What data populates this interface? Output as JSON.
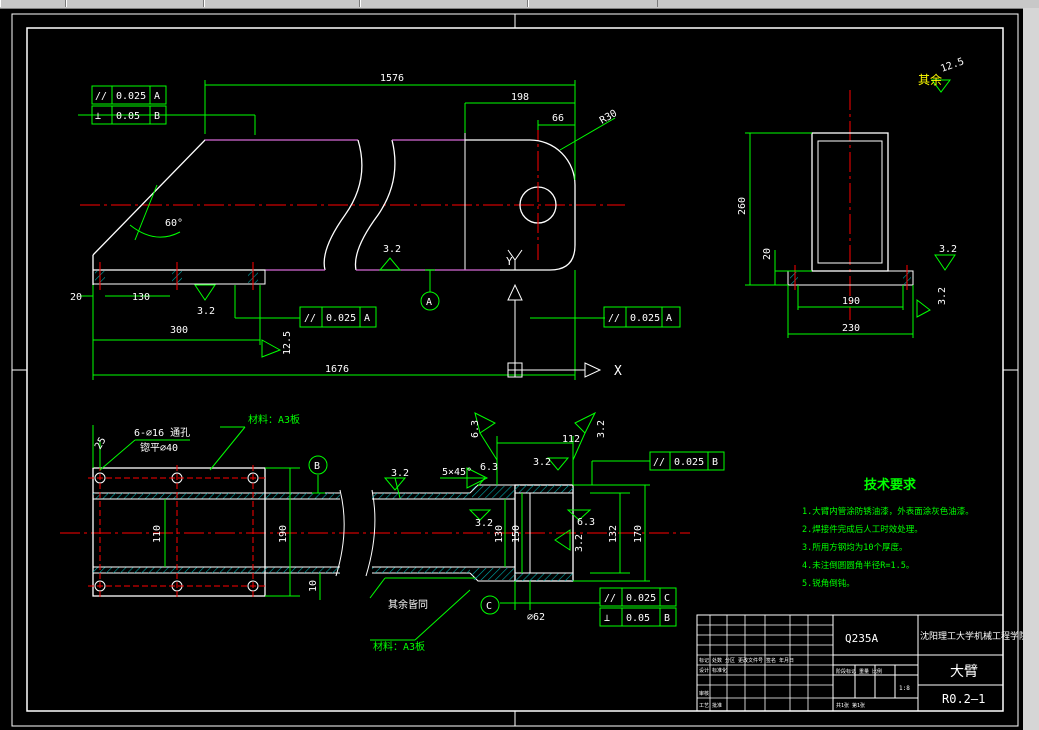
{
  "tabs": [
    "",
    "",
    "",
    "",
    ""
  ],
  "colors": {
    "bg": "#000000",
    "line": "#ffffff",
    "dim": "#00ff00",
    "center": "#ff0000",
    "hidden": "#cc44cc",
    "hatch": "#00aaaa",
    "note": "#ffff00"
  },
  "dims": {
    "top_1576": "1576",
    "d198": "198",
    "d66": "66",
    "r30": "R30",
    "d20": "20",
    "d130": "130",
    "d300": "300",
    "bottom_1576": "1676",
    "angle": "60°",
    "rough1": "3.2",
    "rough2": "3.2",
    "rough3": "12.5",
    "side_260": "260",
    "side_20": "20",
    "side_190": "190",
    "side_230": "230",
    "side_rough1": "3.2",
    "side_rough2": "3.2",
    "plan_110": "110",
    "plan_190": "190",
    "plan_10": "10",
    "plan_25": "25",
    "holes": "6-⌀16 通孔",
    "counter": "锪平⌀40",
    "sec_112": "112",
    "sec_130": "130",
    "sec_150": "150",
    "sec_132": "132",
    "sec_170": "170",
    "sec_62": "⌀62",
    "sec_5x45": "5×45°",
    "sec_r1": "6.3",
    "sec_r2": "6.3",
    "sec_r3": "3.2",
    "sec_r4": "3.2",
    "sec_r5": "6.3",
    "sec_r6": "3.2",
    "sec_r7": "6.3",
    "sec_r8": "3.2",
    "sec_r9": "3.2"
  },
  "gdt": {
    "top_a": {
      "sym": "//",
      "val": "0.025",
      "ref": "A"
    },
    "top_b": {
      "sym": "⊥",
      "val": "0.05",
      "ref": "B"
    },
    "bot_a1": {
      "sym": "//",
      "val": "0.025",
      "ref": "A"
    },
    "bot_a2": {
      "sym": "//",
      "val": "0.025",
      "ref": "A"
    },
    "sec_b": {
      "sym": "//",
      "val": "0.025",
      "ref": "B"
    },
    "sec_c": {
      "sym": "//",
      "val": "0.025",
      "ref": "C"
    },
    "sec_cb": {
      "sym": "⊥",
      "val": "0.05",
      "ref": "B"
    }
  },
  "datums": {
    "a": "A",
    "b": "B",
    "c": "C"
  },
  "labels": {
    "rest": "其余",
    "rest_val": "12.5",
    "material1": "材料：A3板",
    "material2": "材料：A3板",
    "rest_same": "其余皆同",
    "axis_y": "Y",
    "axis_x": "X"
  },
  "tech": {
    "title": "技术要求",
    "items": [
      "1.大臂内管涂防锈油漆，外表面涂灰色油漆。",
      "2.焊接件完成后人工时效处理。",
      "3.所用方钢均为10个厚度。",
      "4.未注倒圆圆角半径R=1.5。",
      "5.锐角倒钝。"
    ]
  },
  "title_block": {
    "material": "Q235A",
    "school": "沈阳理工大学机械工程学院",
    "part": "大臂",
    "code": "R0.2—1",
    "scale": "1:8",
    "r_mark": "标记 处数 分区 更改文件号 签名 年月日",
    "r_design": "设计 标准化",
    "r_check": "审核",
    "r_tech": "工艺 批准",
    "stage": "阶段标记 重量 比例",
    "sheets": "共1张 第1张"
  }
}
